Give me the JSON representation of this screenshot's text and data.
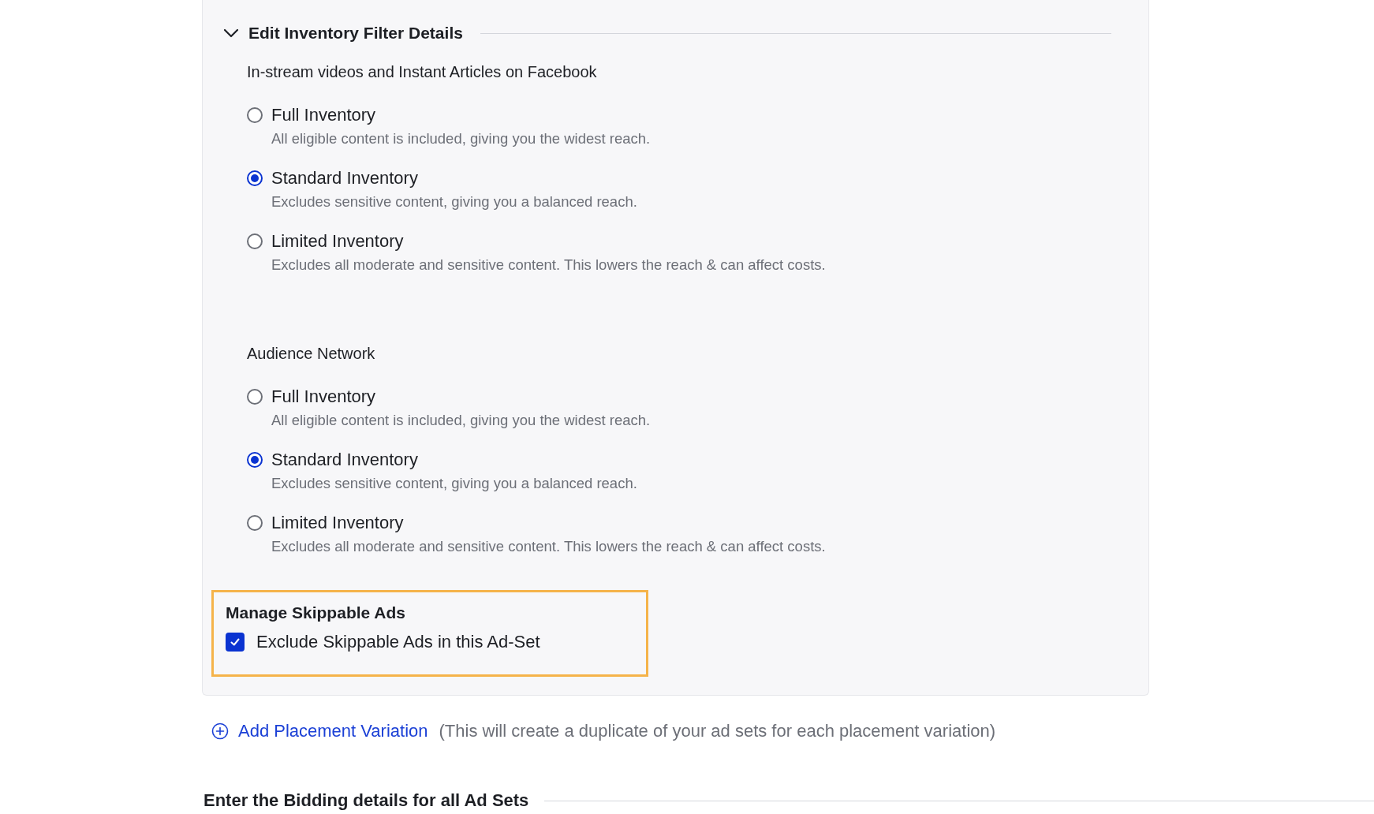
{
  "panel": {
    "title": "Edit Inventory Filter Details",
    "expanded": true,
    "groups": [
      {
        "label": "In-stream videos and Instant Articles on Facebook",
        "options": [
          {
            "label": "Full Inventory",
            "description": "All eligible content is included, giving you the widest reach.",
            "selected": false
          },
          {
            "label": "Standard Inventory",
            "description": "Excludes sensitive content, giving you a balanced reach.",
            "selected": true
          },
          {
            "label": "Limited Inventory",
            "description": "Excludes all moderate and sensitive content. This lowers the reach & can affect costs.",
            "selected": false
          }
        ]
      },
      {
        "label": "Audience Network",
        "options": [
          {
            "label": "Full Inventory",
            "description": "All eligible content is included, giving you the widest reach.",
            "selected": false
          },
          {
            "label": "Standard Inventory",
            "description": "Excludes sensitive content, giving you a balanced reach.",
            "selected": true
          },
          {
            "label": "Limited Inventory",
            "description": "Excludes all moderate and sensitive content. This lowers the reach & can affect costs.",
            "selected": false
          }
        ]
      }
    ],
    "skippable": {
      "title": "Manage Skippable Ads",
      "checkbox": {
        "label": "Exclude Skippable Ads in this Ad-Set",
        "checked": true
      }
    }
  },
  "add_variation": {
    "link": "Add Placement Variation",
    "note": "(This will create a duplicate of your ad sets for each placement variation)"
  },
  "bidding": {
    "title": "Enter the Bidding details for all Ad Sets"
  }
}
